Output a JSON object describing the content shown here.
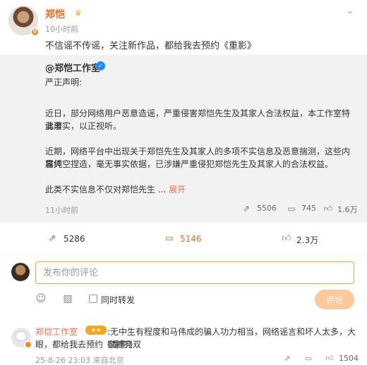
{
  "post": {
    "author": "郑恺",
    "time": "10小时前",
    "text": "不信谣不传谣，关注新作品，都给我去预约《重影》"
  },
  "repost": {
    "author": "@郑恺工作室",
    "lines": [
      "严正声明:",
      "近日，部分网络用户恶意造谣，严重侵害郑恺先生及其家人合法权益，本工作室特此澄",
      "清事实，以正视听。",
      "近期，网络平台中出现关于郑恺先生及其家人的多项不实信息及恶意揣测，这些内容纯",
      "属凭空捏造，毫无事实依据，已涉嫌严重侵犯郑恺先生及其家人的合法权益。",
      "此类不实信息不仅对郑恺先生 ..."
    ],
    "expand": "展开",
    "time": "11小时前",
    "reposts": "5506",
    "comments": "745",
    "likes": "1.6万"
  },
  "actions": {
    "reposts": "5286",
    "comments": "5146",
    "likes": "2.3万"
  },
  "comment_box": {
    "placeholder": "发布你的评论",
    "repost_label": "同时转发",
    "submit_label": "评论"
  },
  "reply": {
    "name": "郑恺工作室",
    "text_line1": ":无中生有程度和马伟成的骗人功力相当，网络谣言和坏人太多，大家擦亮双",
    "text_line2": "眼，都给我去预约《重影》",
    "meta": "25-8-26 23:03 来自北京",
    "likes": "1504"
  },
  "icons": [
    "crown-icon",
    "chevron-down-icon",
    "verified-icon",
    "repost-icon",
    "comment-icon",
    "like-icon",
    "emoji-icon",
    "image-icon",
    "share-icon"
  ],
  "colors": {
    "accent": "#f06b1c",
    "link": "#eb7350",
    "input_border": "#f5a342",
    "submit_bg": "#fbc99a",
    "repost_bg": "#f2f2f2"
  }
}
